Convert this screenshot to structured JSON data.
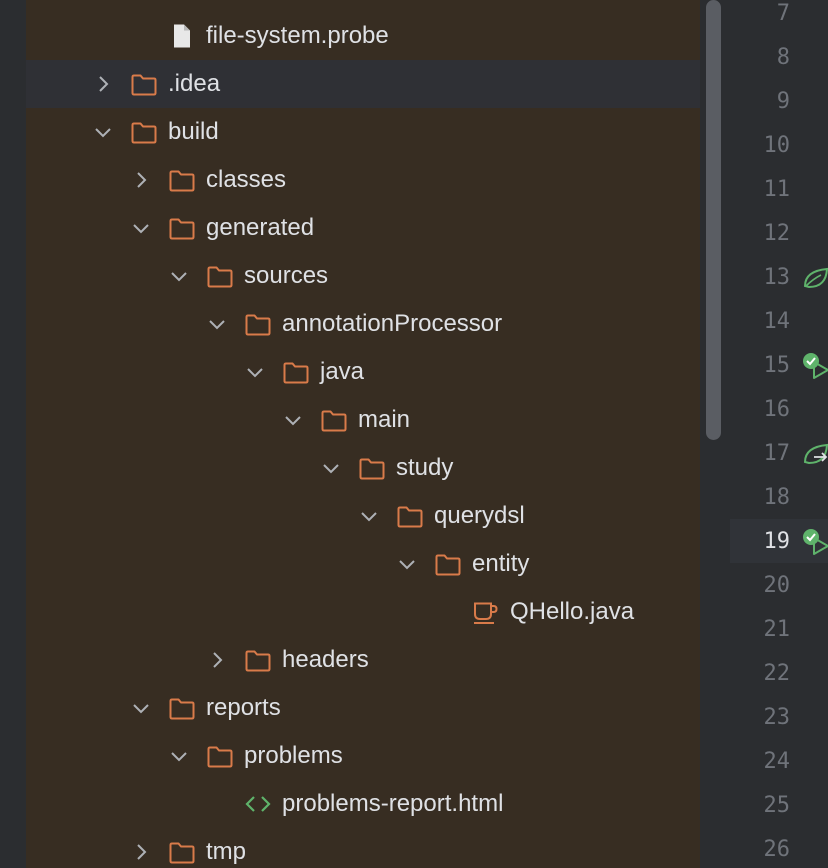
{
  "tree": {
    "rows": [
      {
        "label": "file-system.probe",
        "icon": "file-icon",
        "expand": "none",
        "depth": 3,
        "selected": false
      },
      {
        "label": ".idea",
        "icon": "folder-icon",
        "expand": "collapsed",
        "depth": 2,
        "selected": true
      },
      {
        "label": "build",
        "icon": "folder-icon",
        "expand": "expanded",
        "depth": 2,
        "selected": false
      },
      {
        "label": "classes",
        "icon": "folder-icon",
        "expand": "collapsed",
        "depth": 3,
        "selected": false
      },
      {
        "label": "generated",
        "icon": "folder-icon",
        "expand": "expanded",
        "depth": 3,
        "selected": false
      },
      {
        "label": "sources",
        "icon": "folder-icon",
        "expand": "expanded",
        "depth": 4,
        "selected": false
      },
      {
        "label": "annotationProcessor",
        "icon": "folder-icon",
        "expand": "expanded",
        "depth": 5,
        "selected": false
      },
      {
        "label": "java",
        "icon": "folder-icon",
        "expand": "expanded",
        "depth": 6,
        "selected": false
      },
      {
        "label": "main",
        "icon": "folder-icon",
        "expand": "expanded",
        "depth": 7,
        "selected": false
      },
      {
        "label": "study",
        "icon": "folder-icon",
        "expand": "expanded",
        "depth": 8,
        "selected": false
      },
      {
        "label": "querydsl",
        "icon": "folder-icon",
        "expand": "expanded",
        "depth": 9,
        "selected": false
      },
      {
        "label": "entity",
        "icon": "folder-icon",
        "expand": "expanded",
        "depth": 10,
        "selected": false
      },
      {
        "label": "QHello.java",
        "icon": "java-class-icon",
        "expand": "none",
        "depth": 11,
        "selected": false
      },
      {
        "label": "headers",
        "icon": "folder-icon",
        "expand": "collapsed",
        "depth": 5,
        "selected": false
      },
      {
        "label": "reports",
        "icon": "folder-icon",
        "expand": "expanded",
        "depth": 3,
        "selected": false
      },
      {
        "label": "problems",
        "icon": "folder-icon",
        "expand": "expanded",
        "depth": 4,
        "selected": false
      },
      {
        "label": "problems-report.html",
        "icon": "html-file-icon",
        "expand": "none",
        "depth": 5,
        "selected": false
      },
      {
        "label": "tmp",
        "icon": "folder-icon",
        "expand": "collapsed",
        "depth": 3,
        "selected": false
      }
    ]
  },
  "gutter": {
    "current_line": "19",
    "lines": [
      "7",
      "8",
      "9",
      "10",
      "11",
      "12",
      "13",
      "14",
      "15",
      "16",
      "17",
      "18",
      "19",
      "20",
      "21",
      "22",
      "23",
      "24",
      "25",
      "26"
    ],
    "marks": [
      {
        "line": "13",
        "icon": "spring-bean-icon"
      },
      {
        "line": "15",
        "icon": "run-test-passed-icon"
      },
      {
        "line": "17",
        "icon": "spring-bean-navigate-icon"
      },
      {
        "line": "19",
        "icon": "run-test-passed-icon"
      }
    ]
  },
  "colors": {
    "tree_background": "#372d22",
    "selected_row": "#2f3035",
    "folder": "#d97b4a",
    "file": "#e8e8e8",
    "html_tag": "#5fb36b",
    "text": "#dfe1e5",
    "line_number": "#6f737a",
    "spring_green": "#5fb36b"
  }
}
